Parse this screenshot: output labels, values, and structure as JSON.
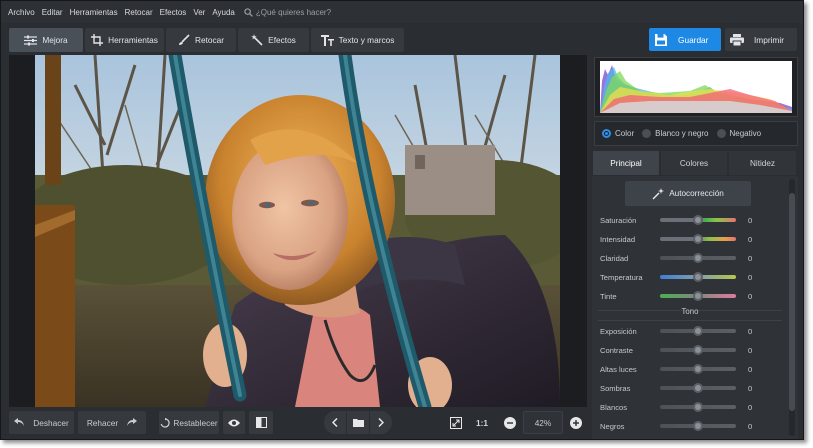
{
  "menu": [
    "Archivo",
    "Editar",
    "Herramientas",
    "Retocar",
    "Efectos",
    "Ver",
    "Ayuda"
  ],
  "search": {
    "placeholder": "¿Qué quieres hacer?"
  },
  "tabs": [
    {
      "label": "Mejora",
      "icon": "sliders-icon",
      "active": true
    },
    {
      "label": "Herramientas",
      "icon": "crop-icon"
    },
    {
      "label": "Retocar",
      "icon": "brush-icon"
    },
    {
      "label": "Efectos",
      "icon": "magic-wand-icon"
    },
    {
      "label": "Texto y marcos",
      "icon": "text-icon"
    }
  ],
  "actions": {
    "save": "Guardar",
    "print": "Imprimir"
  },
  "color_modes": [
    {
      "label": "Color",
      "selected": true
    },
    {
      "label": "Blanco y negro",
      "selected": false
    },
    {
      "label": "Negativo",
      "selected": false
    }
  ],
  "panel_tabs": [
    {
      "label": "Principal",
      "active": true
    },
    {
      "label": "Colores",
      "active": false
    },
    {
      "label": "Nitidez",
      "active": false
    }
  ],
  "autocorrect": "Autocorrección",
  "color_sliders": [
    {
      "label": "Saturación",
      "value": "0",
      "gradient": [
        "#6b7078",
        "#4caf50",
        "#e57373"
      ]
    },
    {
      "label": "Intensidad",
      "value": "0",
      "gradient": [
        "#6b7078",
        "#8bc34a",
        "#e57373"
      ]
    },
    {
      "label": "Claridad",
      "value": "0",
      "gradient": [
        "#4d5258",
        "#5b6066"
      ]
    },
    {
      "label": "Temperatura",
      "value": "0",
      "gradient": [
        "#3f7fd6",
        "#b7c64b"
      ]
    },
    {
      "label": "Tinte",
      "value": "0",
      "gradient": [
        "#4caf50",
        "#e07a9e"
      ]
    }
  ],
  "tone_title": "Tono",
  "tone_sliders": [
    {
      "label": "Exposición",
      "value": "0"
    },
    {
      "label": "Contraste",
      "value": "0"
    },
    {
      "label": "Altas luces",
      "value": "0"
    },
    {
      "label": "Sombras",
      "value": "0"
    },
    {
      "label": "Blancos",
      "value": "0"
    },
    {
      "label": "Negros",
      "value": "0"
    }
  ],
  "bottom": {
    "undo": "Deshacer",
    "redo": "Rehacer",
    "reset": "Restablecer",
    "ratio": "1:1",
    "zoom": "42%"
  },
  "colors": {
    "accent": "#1e88e5",
    "panel": "#2a2d31"
  }
}
